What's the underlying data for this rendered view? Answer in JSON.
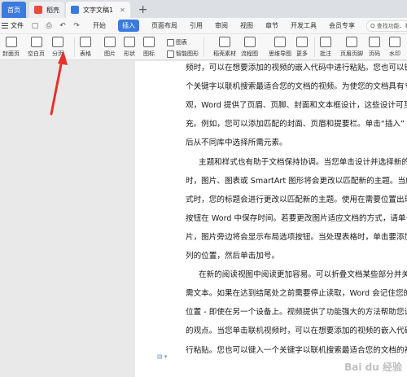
{
  "tabs": {
    "home": "首页",
    "items": [
      {
        "label": "稻壳",
        "color": "#e84c3d"
      },
      {
        "label": "文字文稿1",
        "color": "#3a7be0"
      }
    ],
    "add": "+"
  },
  "menubar": {
    "file": "文件",
    "items": [
      "开始",
      "插入",
      "页面布局",
      "引用",
      "审阅",
      "视图",
      "章节",
      "开发工具",
      "会员专享"
    ],
    "active_index": 1,
    "search_placeholder": "Q 查找功能、模"
  },
  "ribbon": {
    "cover_page": "封面页",
    "blank_page": "空白页",
    "page_break": "分页",
    "table": "表格",
    "picture": "图片",
    "shape": "形状",
    "icon": "图标",
    "chart": "图表",
    "smart_graphic": "智能图形",
    "docer_materials": "稻壳素材",
    "flowchart": "流程图",
    "mindmap": "思维导图",
    "more": "更多",
    "comment": "批注",
    "header_footer": "页眉页脚",
    "page_number": "页码",
    "watermark_btn": "水印"
  },
  "document": {
    "lines": [
      {
        "text": "频时，可以在想要添加的视频的嵌入代码中进行粘贴。您也可以键",
        "indent": false
      },
      {
        "text": "个关键字以联机搜索最适合您的文档的视频。为使您的文档具有专",
        "indent": false
      },
      {
        "text": "观，Word 提供了页眉、页脚、封面和文本框设计，这些设计可互",
        "indent": false
      },
      {
        "text": "充。例如，您可以添加匹配的封面、页眉和提要栏。单击“插入”",
        "indent": false
      },
      {
        "text": "后从不同库中选择所需元素。",
        "indent": false
      },
      {
        "text": "主题和样式也有助于文档保持协调。当您单击设计并选择新的",
        "indent": true
      },
      {
        "text": "时，图片、图表或 SmartArt 图形将会更改以匹配新的主题。当应",
        "indent": false
      },
      {
        "text": "式时，您的标题会进行更改以匹配新的主题。使用在需要位置出现",
        "indent": false
      },
      {
        "text": "按钮在 Word 中保存时间。若要更改图片适应文档的方式，请单击",
        "indent": false
      },
      {
        "text": "片，图片旁边将会显示布局选项按钮。当处理表格时，单击要添加",
        "indent": false
      },
      {
        "text": "列的位置，然后单击加号。",
        "indent": false
      },
      {
        "text": "在新的阅读视图中阅读更加容易。可以折叠文档某些部分并关",
        "indent": true
      },
      {
        "text": "需文本。如果在达到结尾处之前需要停止读取，Word 会记住您的",
        "indent": false
      },
      {
        "text": "位置 - 即使在另一个设备上。视频提供了功能强大的方法帮助您证",
        "indent": false
      },
      {
        "text": "的观点。当您单击联机视频时，可以在想要添加的视频的嵌入代码",
        "indent": false
      },
      {
        "text": "行粘贴。您也可以键入一个关键字以联机搜索最适合您的文档的视",
        "indent": false
      }
    ]
  },
  "watermark_text": "Bai du 经验",
  "colors": {
    "accent": "#3a7be0",
    "arrow": "#e8312c",
    "page": "#ffffff",
    "canvas": "#e9e9e9"
  }
}
